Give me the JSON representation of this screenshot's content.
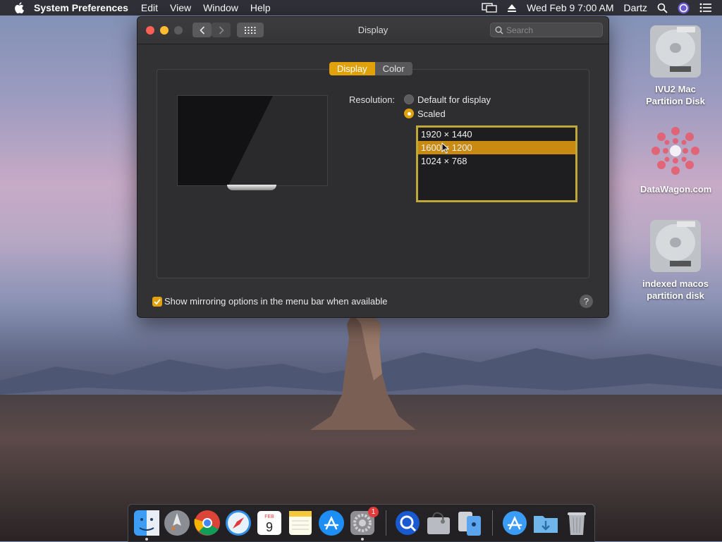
{
  "menubar": {
    "app_name": "System Preferences",
    "menus": [
      "Edit",
      "View",
      "Window",
      "Help"
    ],
    "datetime": "Wed Feb 9  7:00 AM",
    "user": "Dartz"
  },
  "window": {
    "title": "Display",
    "search_placeholder": "Search",
    "tabs": [
      {
        "label": "Display",
        "active": true
      },
      {
        "label": "Color",
        "active": false
      }
    ],
    "resolution_label": "Resolution:",
    "options": [
      {
        "label": "Default for display",
        "selected": false
      },
      {
        "label": "Scaled",
        "selected": true
      }
    ],
    "resolutions": [
      {
        "label": "1920 × 1440",
        "selected": false
      },
      {
        "label": "1600 × 1200",
        "selected": true
      },
      {
        "label": "1024 × 768",
        "selected": false
      }
    ],
    "mirroring_label": "Show mirroring options in the menu bar when available",
    "mirroring_checked": true,
    "help_label": "?"
  },
  "desktop_icons": [
    {
      "name": "IVU2 Mac Partition Disk",
      "line1": "IVU2 Mac",
      "line2": "Partition Disk",
      "icon": "hard-drive-icon"
    },
    {
      "name": "DataWagon.com",
      "line1": "DataWagon.com",
      "line2": "",
      "icon": "datawagon-logo-icon"
    },
    {
      "name": "indexed macos partition disk",
      "line1": "indexed macos",
      "line2": "partition disk",
      "icon": "hard-drive-icon"
    }
  ],
  "dock": {
    "items": [
      "finder-icon",
      "launchpad-icon",
      "chrome-icon",
      "safari-icon",
      "calendar-icon",
      "notes-icon",
      "app-store-icon",
      "system-preferences-icon",
      "search-app-icon",
      "disk-utility-icon",
      "migration-assistant-icon",
      "app-store-folder-icon",
      "downloads-folder-icon",
      "trash-icon"
    ],
    "calendar_month": "FEB",
    "calendar_day": "9",
    "badge": "1"
  },
  "colors": {
    "accent": "#e0a10a",
    "selection": "#c98a12",
    "focus_ring": "#bfa83a"
  }
}
